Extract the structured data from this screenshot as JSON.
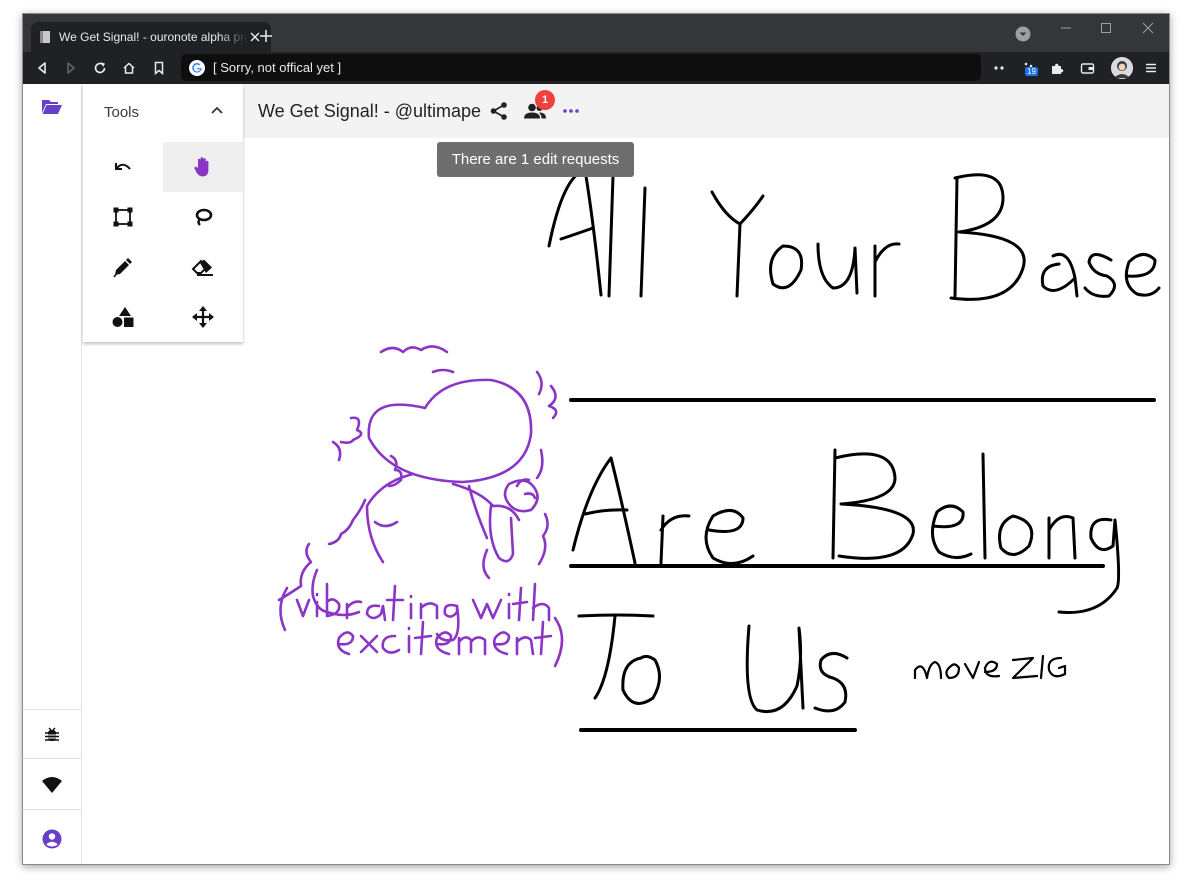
{
  "browser": {
    "tab_title": "We Get Signal! - ouronote alpha preview",
    "address": "[ Sorry, not offical yet ]",
    "extension_badge": "19"
  },
  "tools_panel": {
    "title": "Tools",
    "tools": [
      "undo-icon",
      "hand-icon",
      "select-box-icon",
      "lasso-icon",
      "pen-icon",
      "eraser-icon",
      "shapes-icon",
      "move-icon"
    ],
    "active_tool": "hand-icon"
  },
  "document": {
    "title": "We Get Signal! - @ultimape",
    "edit_request_count": "1",
    "tooltip": "There are 1 edit requests"
  },
  "colors": {
    "accent": "#6a3fc8",
    "ink": "#000000",
    "sketch": "#8a35c6",
    "badge": "#f0413a"
  },
  "rail": {
    "top_icon": "folder-open-icon",
    "bottom_icons": [
      "bug-icon",
      "wifi-icon",
      "account-icon"
    ]
  }
}
